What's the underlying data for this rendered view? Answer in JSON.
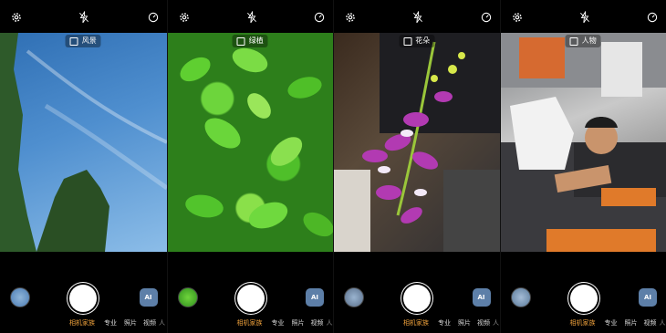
{
  "panels": [
    {
      "scene_label": "风景",
      "scene_icon": "landscape-icon",
      "modes": [
        "相机家族",
        "专业",
        "照片",
        "视频",
        "人"
      ],
      "thumb_color": "#4a7bb4"
    },
    {
      "scene_label": "绿植",
      "scene_icon": "plant-icon",
      "modes": [
        "相机家族",
        "专业",
        "照片",
        "视频",
        "人"
      ],
      "thumb_color": "#2f8f1e"
    },
    {
      "scene_label": "花朵",
      "scene_icon": "flower-icon",
      "modes": [
        "相机家族",
        "专业",
        "照片",
        "视频",
        "人"
      ],
      "thumb_color": "#5a6f8a"
    },
    {
      "scene_label": "人物",
      "scene_icon": "person-icon",
      "modes": [
        "相机家族",
        "专业",
        "照片",
        "视频",
        "人"
      ],
      "thumb_color": "#5a7a9a"
    }
  ],
  "ai_label": "AI",
  "colors": {
    "active_mode": "#f0a23c",
    "ai_button": "#5d7fa8",
    "background": "#000000"
  }
}
